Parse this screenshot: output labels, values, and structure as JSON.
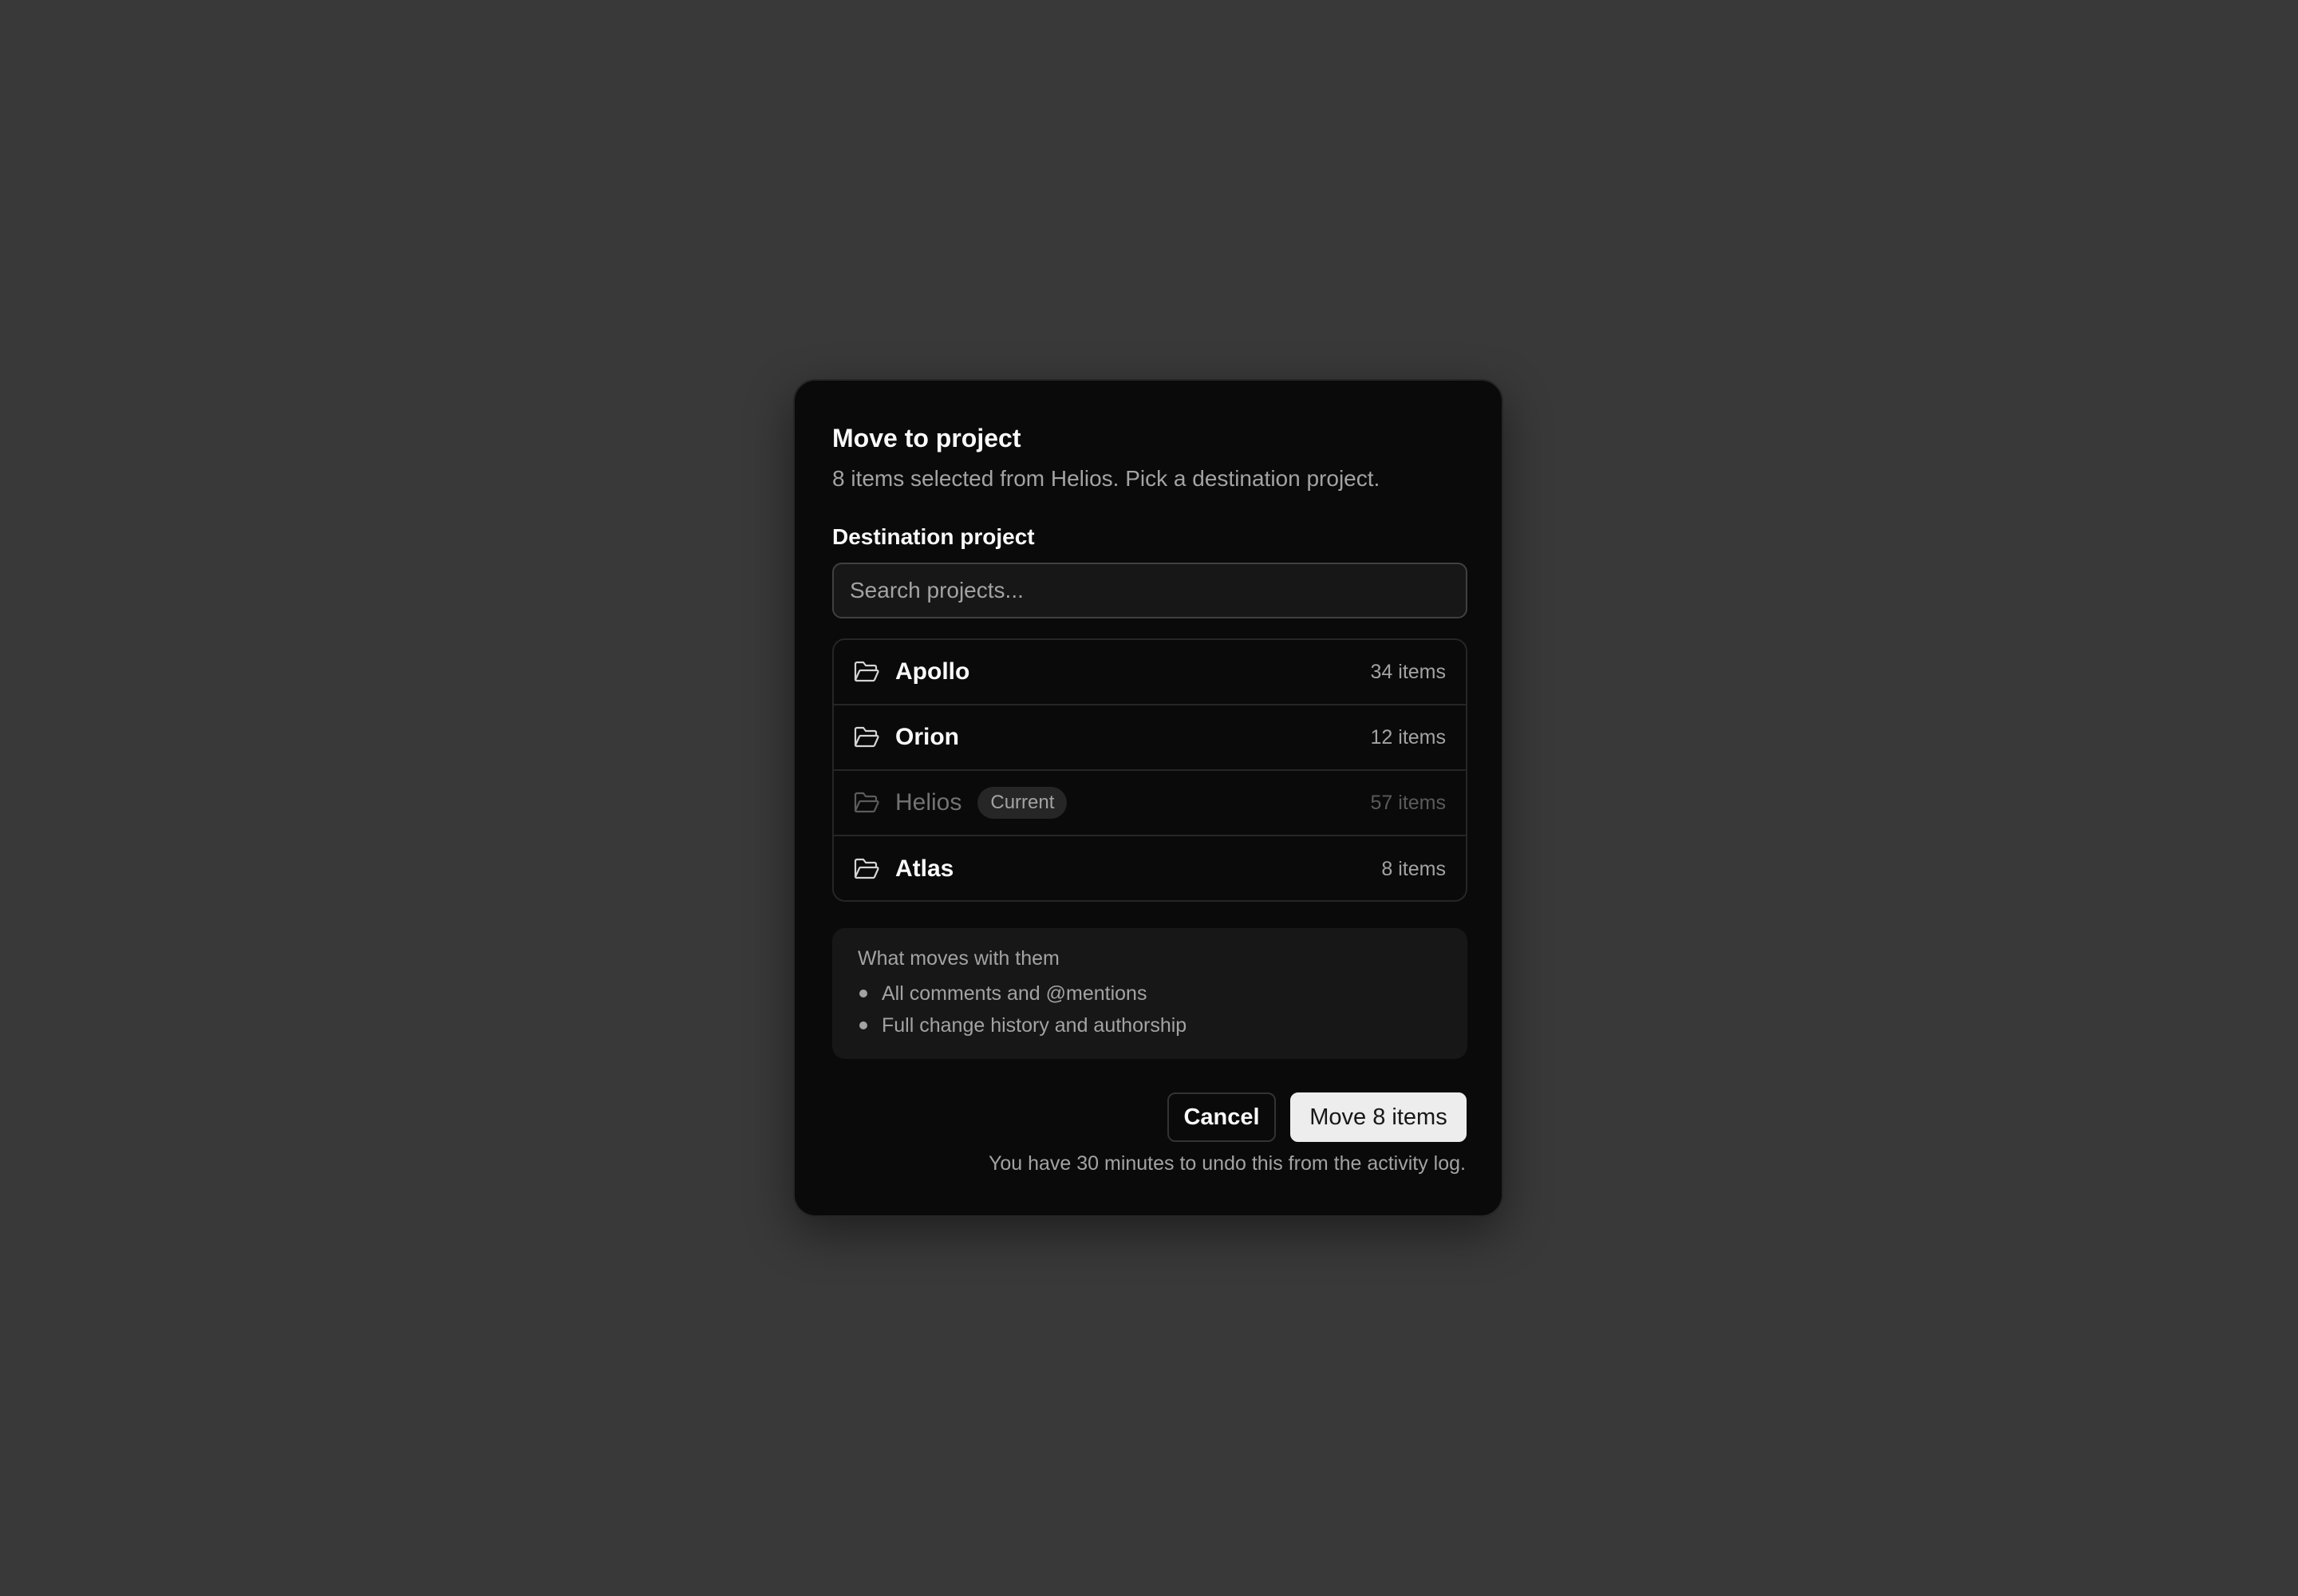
{
  "dialog": {
    "title": "Move to project",
    "subtitle": "8 items selected from Helios. Pick a destination project.",
    "field_label": "Destination project",
    "search_placeholder": "Search projects...",
    "search_value": "",
    "projects": [
      {
        "name": "Apollo",
        "count": "34 items",
        "icon": "folder-open-icon",
        "disabled": false
      },
      {
        "name": "Orion",
        "count": "12 items",
        "icon": "folder-open-icon",
        "disabled": false
      },
      {
        "name": "Helios",
        "badge": "Current",
        "count": "57 items",
        "icon": "folder-open-icon",
        "disabled": true
      },
      {
        "name": "Atlas",
        "count": "8 items",
        "icon": "folder-open-icon",
        "disabled": false
      }
    ],
    "info": {
      "heading": "What moves with them",
      "items": [
        "All comments and @mentions",
        "Full change history and authorship"
      ]
    },
    "cancel_label": "Cancel",
    "confirm_label": "Move 8 items",
    "footnote": "You have 30 minutes to undo this from the activity log."
  },
  "colors": {
    "backdrop": "#393939",
    "dialog_bg": "#0a0a0a",
    "primary_button_bg": "#ededed",
    "muted_text": "#a3a3a3"
  }
}
